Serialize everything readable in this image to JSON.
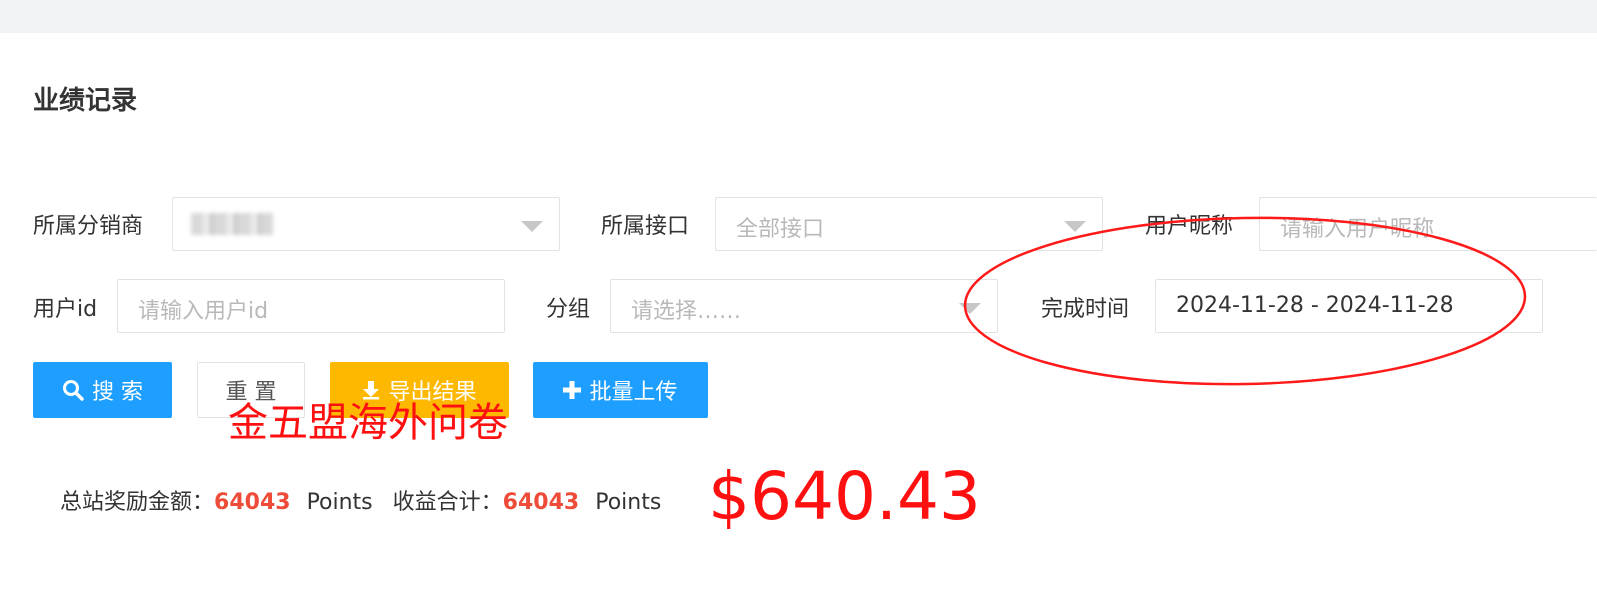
{
  "page": {
    "title": "业绩记录"
  },
  "filters": {
    "distributor": {
      "label": "所属分销商"
    },
    "api": {
      "label": "所属接口",
      "placeholder": "全部接口"
    },
    "nickname": {
      "label": "用户昵称",
      "placeholder": "请输入用户昵称"
    },
    "user_id": {
      "label": "用户id",
      "placeholder": "请输入用户id"
    },
    "group": {
      "label": "分组",
      "placeholder": "请选择……"
    },
    "finish_time": {
      "label": "完成时间",
      "value": "2024-11-28 - 2024-11-28"
    }
  },
  "buttons": {
    "search": "搜 索",
    "reset": "重 置",
    "export": "导出结果",
    "batch_upload": "批量上传"
  },
  "stats": {
    "total_reward_label": "总站奖励金额：",
    "total_reward_value": "64043",
    "unit": "Points",
    "income_label": "收益合计：",
    "income_value": "64043"
  },
  "annotations": {
    "overlay_title": "金五盟海外问卷",
    "dollar_amount": "$640.43"
  },
  "colors": {
    "primary": "#1e9fff",
    "warning": "#ffb800",
    "stat_number": "#ee4b38",
    "annotation": "#ff1010"
  },
  "icons": [
    "search-icon",
    "download-icon",
    "plus-icon",
    "chevron-down-icon"
  ]
}
